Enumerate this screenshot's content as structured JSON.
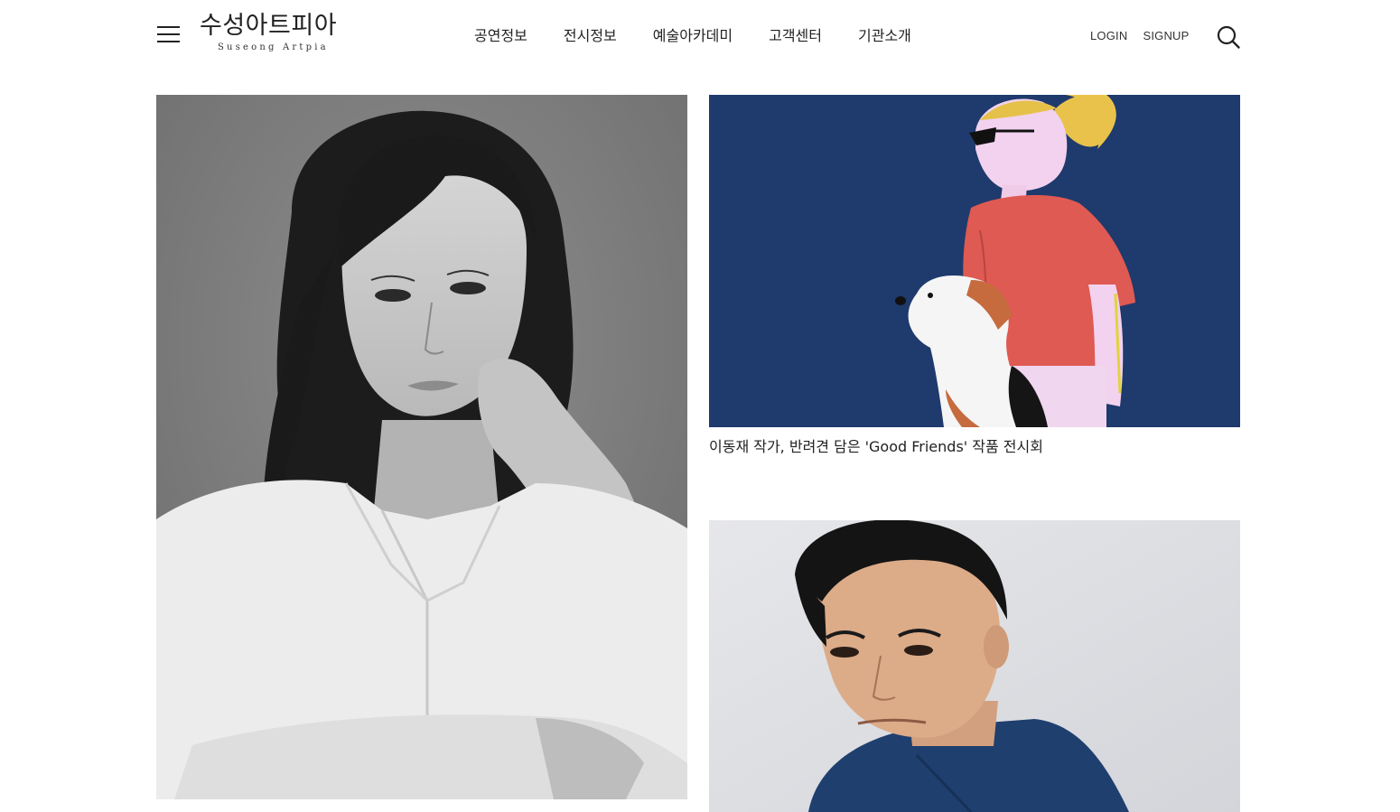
{
  "header": {
    "logo_ko": "수성아트피아",
    "logo_en": "Suseong Artpia",
    "nav": [
      "공연정보",
      "전시정보",
      "예술아카데미",
      "고객센터",
      "기관소개"
    ],
    "login_label": "LOGIN",
    "signup_label": "SIGNUP"
  },
  "icons": {
    "menu": "hamburger-menu-icon",
    "search": "search-icon"
  },
  "cards": [
    {
      "image": "black-and-white portrait photo of a woman",
      "caption": ""
    },
    {
      "image": "painting of a blonde woman in sunglasses with a terrier on blue background",
      "caption": "이동재 작가, 반려견 담은 'Good Friends' 작품 전시회"
    },
    {
      "image": "portrait photo of a man in a denim shirt",
      "caption": ""
    }
  ],
  "colors": {
    "text": "#222222",
    "painting_bg": "#1e3a6e",
    "background": "#ffffff"
  }
}
